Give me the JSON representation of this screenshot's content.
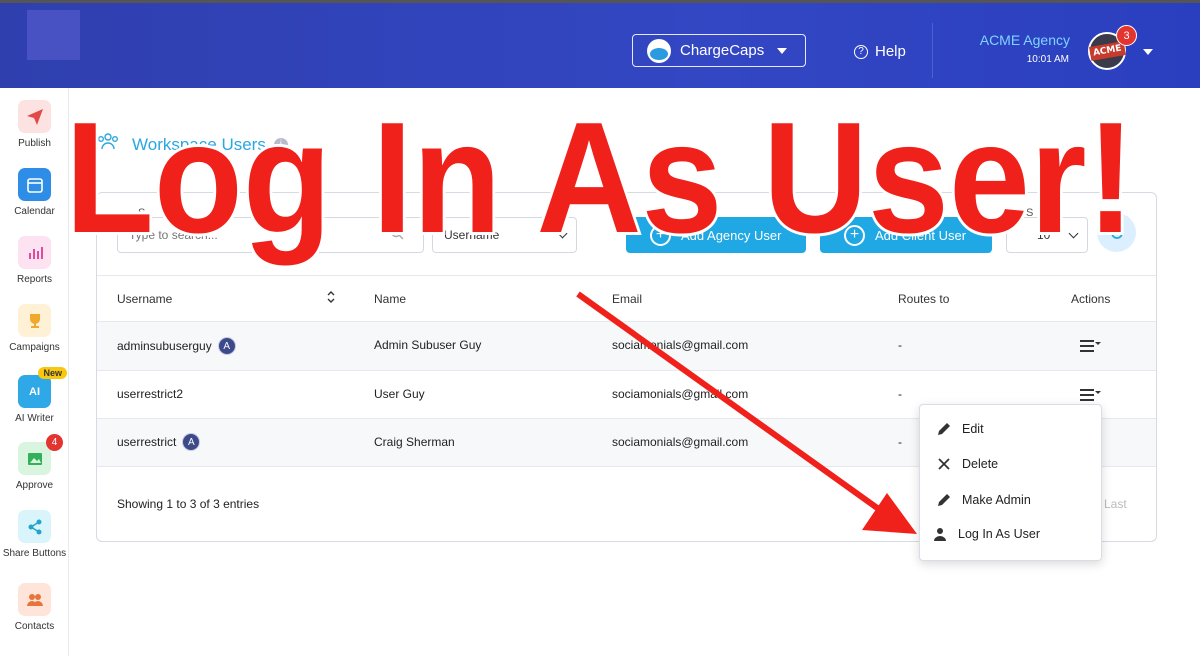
{
  "header": {
    "workspace_label": "ChargeCaps",
    "help_label": "Help",
    "agency_name": "ACME Agency",
    "time": "10:01 AM",
    "avatar_text": "ACME",
    "notification_count": "3"
  },
  "sidebar": {
    "items": [
      {
        "label": "Publish",
        "icon": "paper-plane-icon",
        "bg": "#fde2e2",
        "color": "#e24a4a"
      },
      {
        "label": "Calendar",
        "icon": "calendar-icon",
        "bg": "#2e8de6",
        "color": "#ffffff"
      },
      {
        "label": "Reports",
        "icon": "bar-chart-icon",
        "bg": "#fde2f1",
        "color": "#e24aa0"
      },
      {
        "label": "Campaigns",
        "icon": "trophy-icon",
        "bg": "#fff1d6",
        "color": "#f0a92d"
      },
      {
        "label": "AI Writer",
        "icon": "ai-icon",
        "bg": "#2ea8e6",
        "color": "#ffffff",
        "badge": "New"
      },
      {
        "label": "Approve",
        "icon": "image-check-icon",
        "bg": "#daf5df",
        "color": "#33b15a",
        "badge": "4"
      },
      {
        "label": "Share Buttons",
        "icon": "share-icon",
        "bg": "#d9f4fb",
        "color": "#21a6c9"
      },
      {
        "label": "Contacts",
        "icon": "people-icon",
        "bg": "#ffe5d9",
        "color": "#e8743a"
      }
    ]
  },
  "page": {
    "title": "Workspace Users",
    "info": "i"
  },
  "toolbar": {
    "search_label": "S",
    "search_placeholder": "Type to search...",
    "filter_value": "Username",
    "add_agency_user": "Add Agency User",
    "add_client_user": "Add Client User",
    "per_page_label": "S",
    "per_page_value": "10"
  },
  "table": {
    "columns": [
      "Username",
      "Name",
      "Email",
      "Routes to",
      "Actions"
    ],
    "rows": [
      {
        "username": "adminsubuserguy",
        "admin": "A",
        "name": "Admin Subuser Guy",
        "email": "sociamonials@gmail.com",
        "routes": "-"
      },
      {
        "username": "userrestrict2",
        "admin": "",
        "name": "User Guy",
        "email": "sociamonials@gmail.com",
        "routes": "-"
      },
      {
        "username": "userrestrict",
        "admin": "A",
        "name": "Craig Sherman",
        "email": "sociamonials@gmail.com",
        "routes": "-"
      }
    ],
    "footer": "Showing 1 to 3 of 3 entries",
    "last": "Last"
  },
  "actions_menu": {
    "items": [
      {
        "label": "Edit",
        "icon": "pencil-icon"
      },
      {
        "label": "Delete",
        "icon": "close-icon"
      },
      {
        "label": "Make Admin",
        "icon": "pencil-icon"
      },
      {
        "label": "Log In As User",
        "icon": "user-icon"
      }
    ]
  },
  "overlay": {
    "headline": "Log In As User!",
    "color": "#f0201a"
  }
}
